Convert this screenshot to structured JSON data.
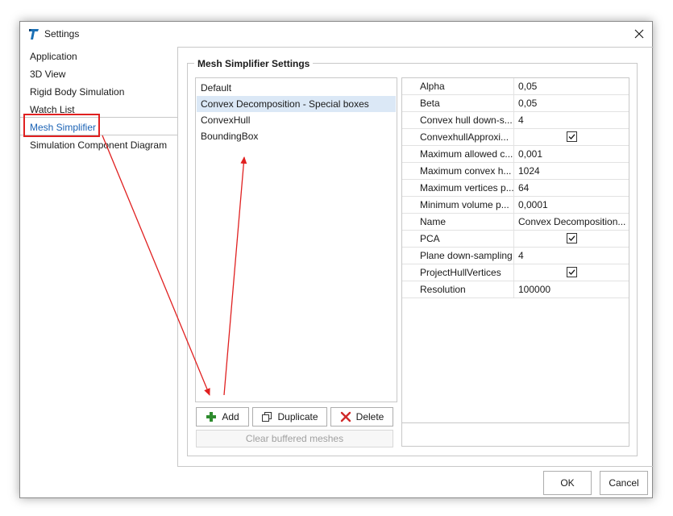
{
  "window": {
    "title": "Settings"
  },
  "nav": {
    "items": [
      {
        "label": "Application"
      },
      {
        "label": "3D View"
      },
      {
        "label": "Rigid Body Simulation"
      },
      {
        "label": "Watch List"
      },
      {
        "label": "Mesh Simplifier",
        "selected": true
      },
      {
        "label": "Simulation Component Diagram"
      }
    ]
  },
  "group": {
    "title": "Mesh Simplifier Settings"
  },
  "presets": {
    "items": [
      {
        "label": "Default"
      },
      {
        "label": "Convex Decomposition - Special boxes",
        "selected": true
      },
      {
        "label": "ConvexHull"
      },
      {
        "label": "BoundingBox"
      }
    ],
    "add_label": "Add",
    "duplicate_label": "Duplicate",
    "delete_label": "Delete",
    "clear_label": "Clear buffered meshes"
  },
  "properties": [
    {
      "name": "Alpha",
      "value": "0,05"
    },
    {
      "name": "Beta",
      "value": "0,05"
    },
    {
      "name": "Convex hull down-s...",
      "value": "4"
    },
    {
      "name": "ConvexhullApproxi...",
      "checked": true
    },
    {
      "name": "Maximum allowed c...",
      "value": "0,001"
    },
    {
      "name": "Maximum convex h...",
      "value": "1024"
    },
    {
      "name": "Maximum vertices p...",
      "value": "64"
    },
    {
      "name": "Minimum volume p...",
      "value": "0,0001"
    },
    {
      "name": "Name",
      "value": "Convex Decomposition..."
    },
    {
      "name": "PCA",
      "checked": true
    },
    {
      "name": "Plane down-sampling",
      "value": "4"
    },
    {
      "name": "ProjectHullVertices",
      "checked": true
    },
    {
      "name": "Resolution",
      "value": "100000"
    }
  ],
  "footer": {
    "ok_label": "OK",
    "cancel_label": "Cancel"
  },
  "colors": {
    "accent": "#1a62b5",
    "annotation": "#e02020",
    "selection": "#dbe8f6",
    "add_icon": "#2e8b2e",
    "delete_icon": "#d02a2a"
  },
  "icons": {
    "app": "app-logo-icon",
    "close": "close-icon",
    "add": "plus-icon",
    "duplicate": "duplicate-icon",
    "delete": "delete-x-icon",
    "checkbox": "checkmark-icon"
  }
}
